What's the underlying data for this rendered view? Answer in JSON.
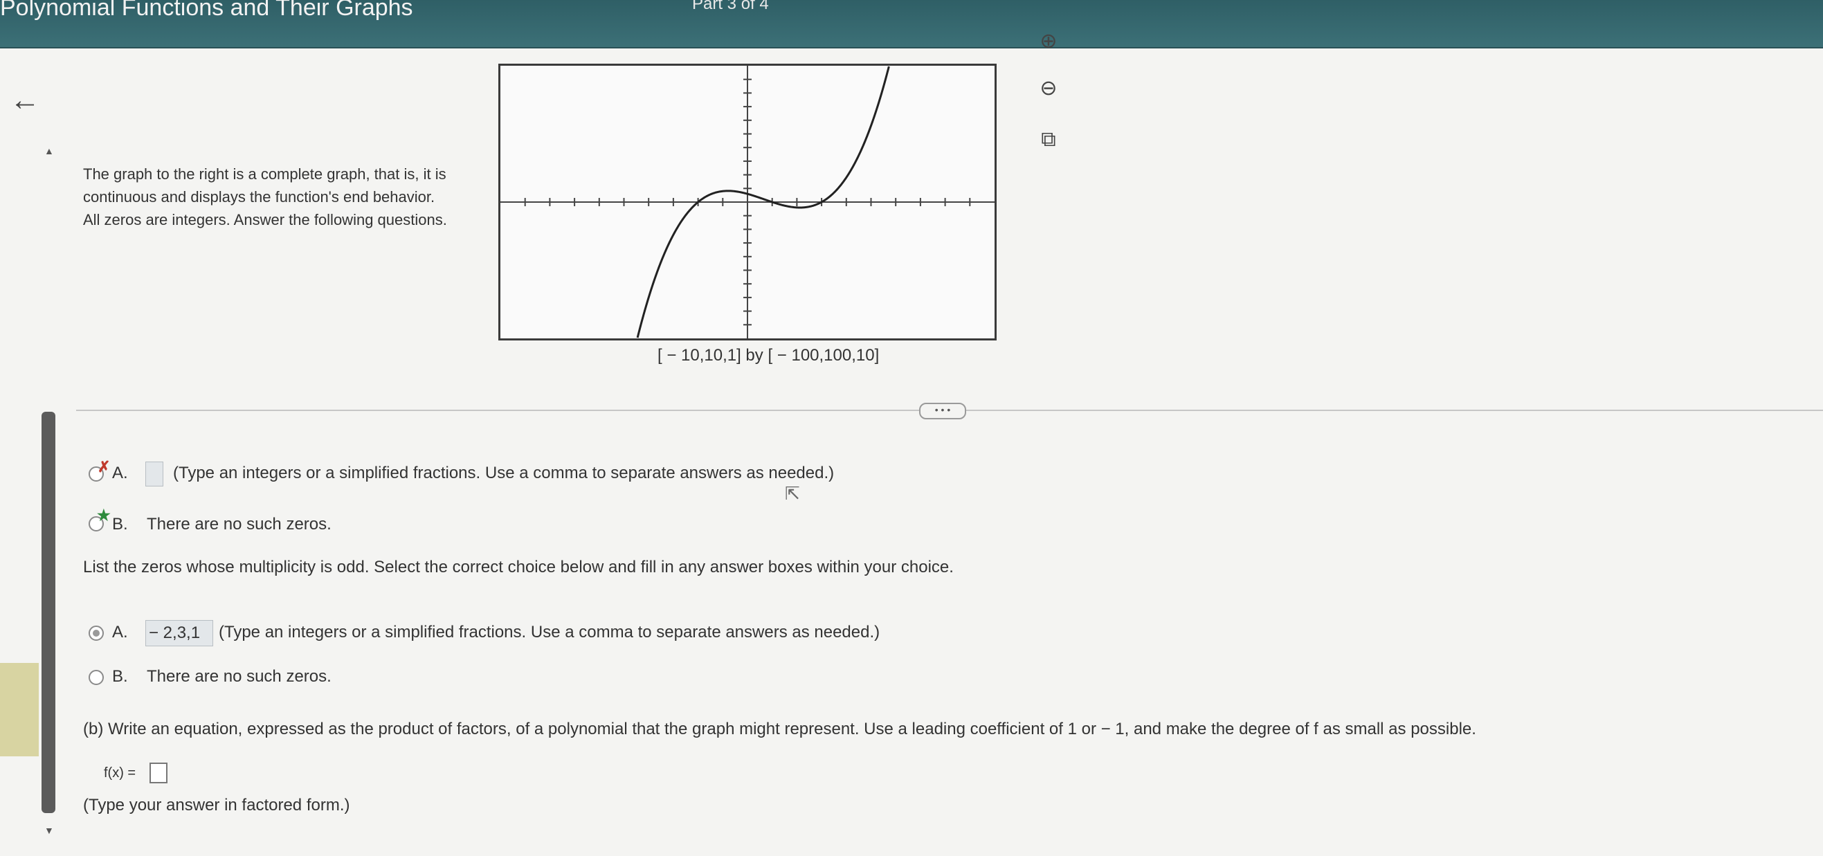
{
  "header": {
    "title": "Polynomial Functions and Their Graphs",
    "part": "Part 3 of 4"
  },
  "icons": {
    "back": "←",
    "zoom_in": "⊕",
    "zoom_out": "⊖",
    "popout": "⧉",
    "scroll_up": "▲",
    "scroll_down": "▼",
    "cursor": "⇱"
  },
  "intro_text": "The graph to the right is a complete graph, that is, it is continuous and displays the function's end behavior. All zeros are integers. Answer the following questions.",
  "graph": {
    "window_label": "[ − 10,10,1] by [ − 100,100,10]",
    "xlim": [
      -10,
      10
    ],
    "xscl": 1,
    "ylim": [
      -100,
      100
    ],
    "yscl": 10,
    "curve_color": "#222222"
  },
  "more_button_label": "• • •",
  "prev_question": {
    "option_a_label": "A.",
    "option_a_hint": "(Type an integers or a simplified fractions. Use a comma to separate answers as needed.)",
    "option_b_label": "B.",
    "option_b_text": "There are no such zeros.",
    "incorrect_mark": "✗",
    "correct_mark": "★"
  },
  "odd_question": {
    "prompt": "List the zeros whose multiplicity is odd. Select the correct choice below and fill in any answer boxes within your choice.",
    "option_a_label": "A.",
    "option_a_value": "− 2,3,1",
    "option_a_hint": "(Type an integers or a simplified fractions. Use a comma to separate answers as needed.)",
    "option_b_label": "B.",
    "option_b_text": "There are no such zeros."
  },
  "part_b": {
    "prompt": "(b) Write an equation, expressed as the product of factors, of a polynomial that the graph might represent. Use a leading coefficient of 1 or − 1, and make the degree of f as small as possible.",
    "fx_label": "f(x) =",
    "hint": "(Type your answer in factored form.)"
  }
}
